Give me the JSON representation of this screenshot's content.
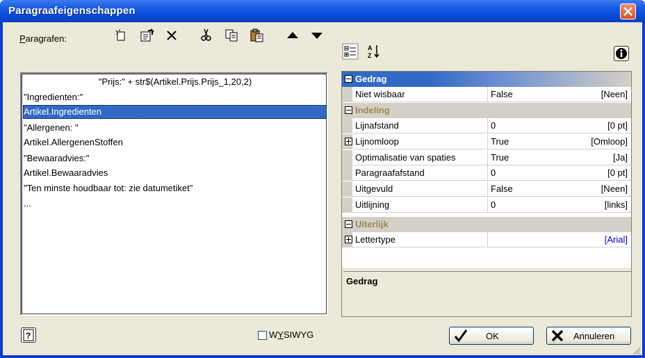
{
  "window": {
    "title": "Paragraafeigenschappen"
  },
  "toolbar": {
    "label_prefix": "P",
    "label_rest": "aragrafen:",
    "icons": [
      "new-paragraph-icon",
      "properties-icon",
      "delete-icon",
      "cut-icon",
      "copy-icon",
      "paste-icon",
      "move-up-icon",
      "move-down-icon"
    ]
  },
  "paragraphs": [
    {
      "text": "\"Prijs:\" + str$(Artikel.Prijs.Prijs_1,20,2)",
      "selected": false,
      "align": "center"
    },
    {
      "text": "\"Ingredienten:\"",
      "selected": false,
      "align": "left"
    },
    {
      "text": "Artikel.Ingredienten",
      "selected": true,
      "align": "left"
    },
    {
      "text": "\"Allergenen: \"",
      "selected": false,
      "align": "left"
    },
    {
      "text": "Artikel.AllergenenStoffen",
      "selected": false,
      "align": "left"
    },
    {
      "text": "\"Bewaaradvies:\"",
      "selected": false,
      "align": "left"
    },
    {
      "text": "Artikel.Bewaaradvies",
      "selected": false,
      "align": "left"
    },
    {
      "text": "\"Ten minste houdbaar tot: zie datumetiket\"",
      "selected": false,
      "align": "left"
    },
    {
      "text": "...",
      "selected": false,
      "align": "left"
    }
  ],
  "properties": {
    "categories": [
      {
        "name": "Gedrag",
        "selected": true
      },
      {
        "name": "Indeling",
        "selected": false
      },
      {
        "name": "Uiterlijk",
        "selected": false
      }
    ],
    "rows": [
      {
        "name": "Niet wisbaar",
        "value": "False",
        "display": "[Neen]",
        "expandable": false
      },
      {
        "name": "Lijnafstand",
        "value": "0",
        "display": "[0 pt]",
        "expandable": false
      },
      {
        "name": "Lijnomloop",
        "value": "True",
        "display": "[Omloop]",
        "expandable": true
      },
      {
        "name": "Optimalisatie van spaties",
        "value": "True",
        "display": "[Ja]",
        "expandable": false
      },
      {
        "name": "Paragraafafstand",
        "value": "0",
        "display": "[0 pt]",
        "expandable": false
      },
      {
        "name": "Uitgevuld",
        "value": "False",
        "display": "[Neen]",
        "expandable": false
      },
      {
        "name": "Uitlijning",
        "value": "0",
        "display": "[links]",
        "expandable": false
      },
      {
        "name": "Lettertype",
        "value": "",
        "display": "[Arial]",
        "expandable": true
      }
    ],
    "description_title": "Gedrag"
  },
  "footer": {
    "wysiwyg_label_prefix": "W",
    "wysiwyg_label_u": "Y",
    "wysiwyg_label_rest": "SIWYG",
    "wysiwyg_checked": false,
    "ok_label": "OK",
    "cancel_label": "Annuleren"
  },
  "colors": {
    "titlebar": "#0a4ad6",
    "selection": "#316ac5",
    "category_text": "#a08850"
  }
}
